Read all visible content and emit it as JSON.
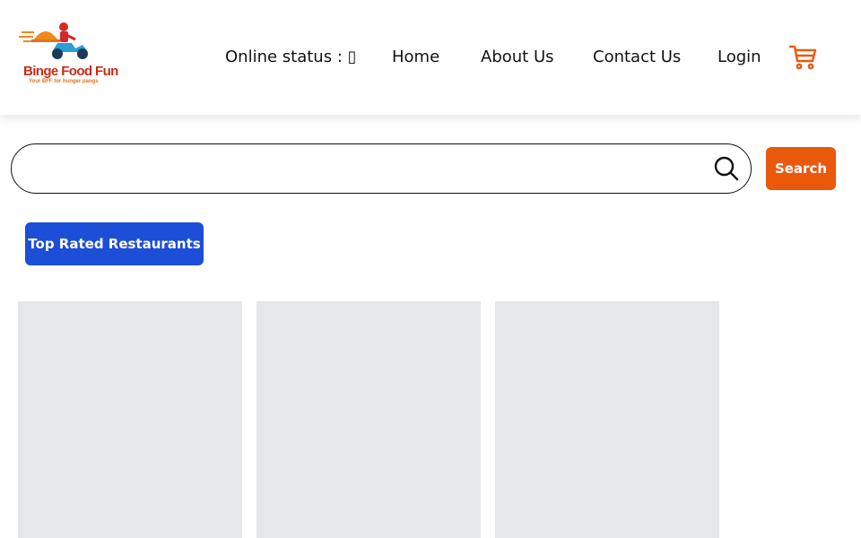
{
  "brand": {
    "title": "Binge Food Fun",
    "tagline": "Your BFF for hunger pangs",
    "colors": {
      "title": "#cc2a12",
      "tagline": "#e0731c"
    }
  },
  "nav": {
    "online_status": "Online status : ▯",
    "home": "Home",
    "about": "About Us",
    "contact": "Contact Us",
    "login": "Login",
    "cart_icon": "cart-icon"
  },
  "search": {
    "value": "",
    "placeholder": "",
    "button_label": "Search",
    "icon": "search-icon"
  },
  "filters": {
    "top_rated_label": "Top Rated Restaurants"
  },
  "restaurants": {
    "loading_cards": 3
  },
  "colors": {
    "accent": "#ea580c",
    "primary": "#1d4ed8",
    "skeleton": "#e5e7eb"
  }
}
